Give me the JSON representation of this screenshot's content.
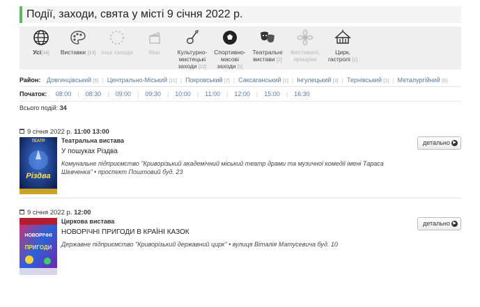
{
  "page": {
    "title": "Події, заходи, свята у місті 9 січня 2022 р."
  },
  "categories": [
    {
      "label": "Усі",
      "count": "[34]",
      "icon": "globe-icon",
      "state": "active"
    },
    {
      "label": "Виставки",
      "count": "[13]",
      "icon": "palette-icon",
      "state": "normal"
    },
    {
      "label": "Інші заходи",
      "count": "",
      "icon": "dotted-circle-icon",
      "state": "dim"
    },
    {
      "label": "Кіно",
      "count": "",
      "icon": "clapperboard-icon",
      "state": "dim"
    },
    {
      "label": "Культурно-мистецькі заходи",
      "count": "[12]",
      "icon": "guitar-icon",
      "state": "normal"
    },
    {
      "label": "Спортивно-масові заходи",
      "count": "[1]",
      "icon": "soccer-ball-icon",
      "state": "normal"
    },
    {
      "label": "Театральні вистави",
      "count": "[2]",
      "icon": "theater-masks-icon",
      "state": "normal"
    },
    {
      "label": "Фестивалі, ярмарки",
      "count": "",
      "icon": "flower-icon",
      "state": "dim"
    },
    {
      "label": "Цирк, гастролі",
      "count": "[1]",
      "icon": "circus-tent-icon",
      "state": "normal"
    }
  ],
  "district": {
    "label": "Район:",
    "items": [
      {
        "name": "Довгинцівський",
        "count": "[5]"
      },
      {
        "name": "Центрально-Міський",
        "count": "[11]"
      },
      {
        "name": "Покровський",
        "count": "[7]"
      },
      {
        "name": "Саксаганський",
        "count": "[1]"
      },
      {
        "name": "Інгулецький",
        "count": "[3]"
      },
      {
        "name": "Тернівський",
        "count": "[1]"
      },
      {
        "name": "Металургійний",
        "count": "[6]"
      }
    ]
  },
  "start": {
    "label": "Початок:",
    "times": [
      "08:00",
      "08:30",
      "09:00",
      "09:30",
      "10:00",
      "11:00",
      "12:00",
      "15:00",
      "16:30"
    ]
  },
  "total": {
    "label": "Всього подій:",
    "value": "34"
  },
  "events": [
    {
      "date": "9 січня 2022 р.",
      "time": "11:00 13:00",
      "type": "Театральна вистава",
      "name": "У пошуках Різдва",
      "place": "Комунальне підприємство \"Криворізький академічний міський театр драми та музичної комедії імені Тараса Шевченка\" • проспект Поштовий буд. 23",
      "button": "детально",
      "poster_top": "ТЕАТР",
      "poster_title": "Різдва"
    },
    {
      "date": "9 січня 2022 р.",
      "time": "12:00",
      "type": "Циркова вистава",
      "name": "НОВОРІЧНІ ПРИГОДИ В КРАЇНІ КАЗОК",
      "place": "Державне підприємство \"Криворізький державний цирк\" • вулиця Віталія Матусевича буд. 10",
      "button": "детально",
      "poster_top": "НОВОРІЧНІ",
      "poster_title": "ПРИГОДИ"
    }
  ]
}
